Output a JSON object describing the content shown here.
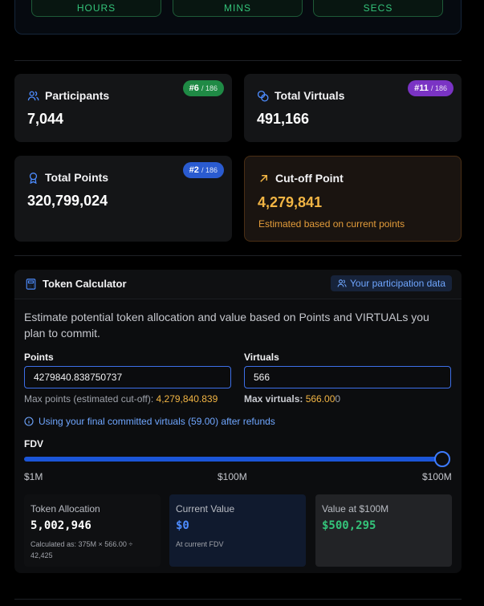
{
  "timer": {
    "labels": [
      "HOURS",
      "MINS",
      "SECS"
    ]
  },
  "stats": {
    "participants": {
      "label": "Participants",
      "value": "7,044",
      "rank": "#6",
      "rank_total": "/ 186",
      "badge_color": "#1f8a45"
    },
    "total_virtuals": {
      "label": "Total Virtuals",
      "value": "491,166",
      "rank": "#11",
      "rank_total": "/ 186",
      "badge_color": "#7a33c4"
    },
    "total_points": {
      "label": "Total Points",
      "value": "320,799,024",
      "rank": "#2",
      "rank_total": "/ 186",
      "badge_color": "#2a5bd0"
    },
    "cutoff": {
      "label": "Cut-off Point",
      "value": "4,279,841",
      "note": "Estimated based on current points"
    }
  },
  "calculator": {
    "title": "Token Calculator",
    "participation_button": "Your participation data",
    "description": "Estimate potential token allocation and value based on Points and VIRTUALs you plan to commit.",
    "points": {
      "label": "Points",
      "value": "4279840.838750737",
      "hint_label": "Max points (estimated cut-off):",
      "hint_value": "4,279,840.839"
    },
    "virtuals": {
      "label": "Virtuals",
      "value": "566",
      "hint_label": "Max virtuals:",
      "hint_value": "566.00",
      "hint_suffix": "0"
    },
    "info": "Using your final committed virtuals (59.00) after refunds",
    "fdv": {
      "label": "FDV",
      "ticks": [
        "$1M",
        "$100M",
        "$100M"
      ],
      "slider_fraction": 1.0
    },
    "results": {
      "allocation": {
        "title": "Token Allocation",
        "value": "5,002,946",
        "note": "Calculated as: 375M × 566.00 ÷ 42,425"
      },
      "current": {
        "title": "Current Value",
        "value": "$0",
        "note": "At current FDV"
      },
      "at_fdv": {
        "title": "Value at $100M",
        "value": "$500,295"
      }
    }
  },
  "colors": {
    "accent_blue": "#3d7bff",
    "warning": "#f2b544",
    "success": "#34c47a"
  }
}
